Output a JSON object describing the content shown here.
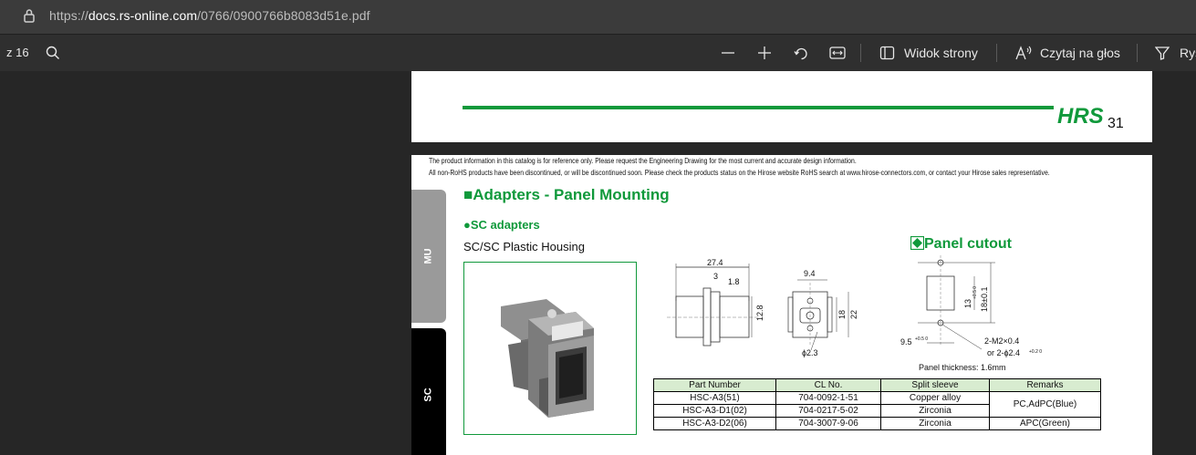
{
  "browser": {
    "url_prefix": "https://",
    "url_host": "docs.rs-online.com",
    "url_path": "/0766/0900766b8083d51e.pdf"
  },
  "toolbar": {
    "page_of": "z 16",
    "page_view_label": "Widok strony",
    "read_aloud_label": "Czytaj na głos",
    "draw_label": "Rys"
  },
  "document": {
    "brand": "HRS",
    "page_number": "31",
    "notice_line1": "The product  information in this catalog is for reference only. Please request the  Engineering Drawing for the most current and accurate design  information.",
    "notice_line2": "All non-RoHS products  have been discontinued, or will be discontinued soon. Please check the  products status on the Hirose website RoHS search at www.hirose-connectors.com, or contact your  Hirose sales representative.",
    "side_tabs": {
      "mu": "MU",
      "sc": "SC"
    },
    "heading": "■Adapters - Panel Mounting",
    "subheading": "●SC adapters",
    "housing": "SC/SC Plastic Housing",
    "panel_cutout": "Panel cutout",
    "panel_thickness": "Panel thickness: 1.6mm",
    "dims": {
      "d27_4": "27.4",
      "d3": "3",
      "d1_8": "1.8",
      "d12_8": "12.8",
      "d9_4": "9.4",
      "d18": "18",
      "d22": "22",
      "phi2_3": "ϕ2.3",
      "d13": "13",
      "d13_tol": "+0.5 0",
      "d18_01": "18±0.1",
      "d9_5": "9.5",
      "d9_5_tol": "+0.5 0",
      "m2": "2-M2×0.4",
      "or_phi": "or 2-ϕ2.4",
      "or_tol": "+0.2 0"
    },
    "table": {
      "headers": [
        "Part Number",
        "CL No.",
        "Split sleeve",
        "Remarks"
      ],
      "rows": [
        [
          "HSC-A3(51)",
          "704-0092-1-51",
          "Copper alloy"
        ],
        [
          "HSC-A3-D1(02)",
          "704-0217-5-02",
          "Zirconia"
        ],
        [
          "HSC-A3-D2(06)",
          "704-3007-9-06",
          "Zirconia"
        ]
      ],
      "remarks": [
        "PC,AdPC(Blue)",
        "APC(Green)"
      ]
    }
  },
  "colors": {
    "accent_green": "#10993b",
    "toolbar_bg": "#2f2f2f",
    "viewer_bg": "#262626"
  }
}
